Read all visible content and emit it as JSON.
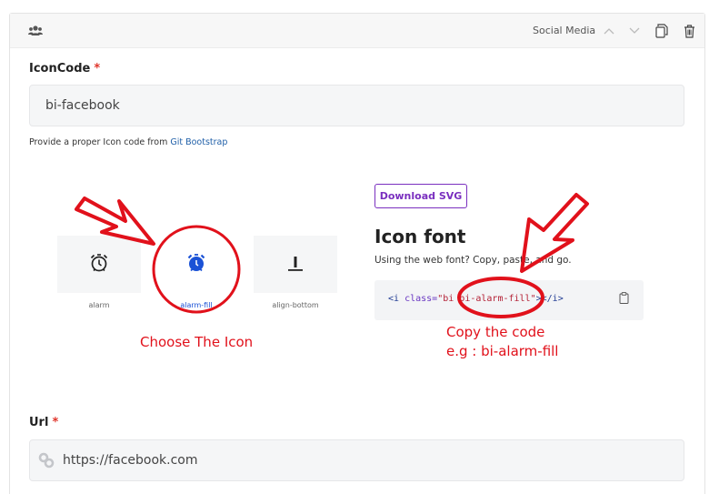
{
  "header": {
    "title": "Social Media",
    "icons": [
      "users-icon",
      "chevron-up-icon",
      "chevron-down-icon",
      "duplicate-icon",
      "trash-icon"
    ]
  },
  "icon_code": {
    "label": "IconCode",
    "required_mark": "*",
    "value": "bi-facebook",
    "help_prefix": "Provide a proper Icon code from ",
    "help_link": "Git Bootstrap"
  },
  "bootstrap_example": {
    "tiles": [
      {
        "label": "alarm",
        "icon": "alarm-icon"
      },
      {
        "label": "alarm-fill",
        "icon": "alarm-fill-icon"
      },
      {
        "label": "align-bottom",
        "icon": "align-bottom-icon"
      }
    ],
    "download_label": "Download SVG",
    "heading": "Icon font",
    "subtext": "Using the web font? Copy, paste, and go.",
    "code": {
      "open": "<i",
      "attr": " class=",
      "str_open": "\"bi ",
      "str_value": "bi-alarm-fill",
      "str_close": "\"",
      "close": "></i>"
    }
  },
  "annotations": {
    "choose": "Choose The Icon",
    "copy_line1": "Copy the code",
    "copy_line2": "e.g : bi-alarm-fill"
  },
  "url": {
    "label": "Url",
    "required_mark": "*",
    "value": "https://facebook.com"
  },
  "colors": {
    "annotation": "#e1111b",
    "accent_purple": "#7a2fbf",
    "active_blue": "#1b52d6",
    "required": "#e0352b"
  }
}
